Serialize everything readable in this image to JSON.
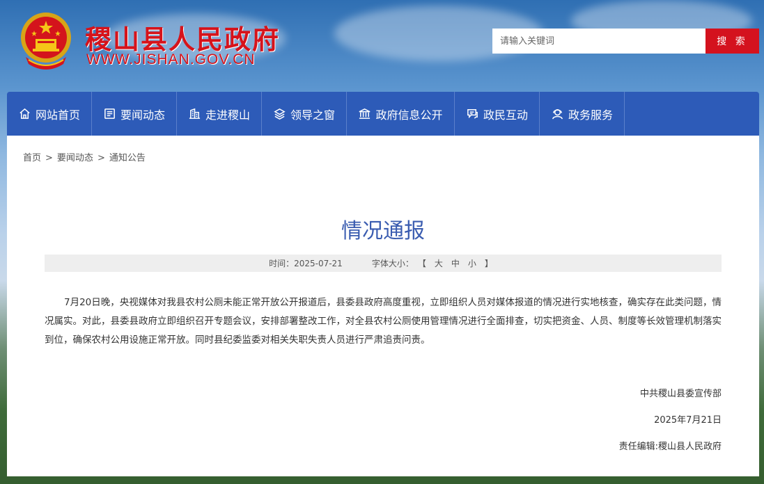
{
  "header": {
    "site_name": "稷山县人民政府",
    "site_url": "WWW.JISHAN.GOV.CN",
    "search": {
      "placeholder": "请输入关键词",
      "button_label": "搜 索"
    }
  },
  "nav": {
    "items": [
      {
        "label": "网站首页",
        "icon": "home-icon"
      },
      {
        "label": "要闻动态",
        "icon": "news-icon"
      },
      {
        "label": "走进稷山",
        "icon": "building-icon"
      },
      {
        "label": "领导之窗",
        "icon": "layers-icon"
      },
      {
        "label": "政府信息公开",
        "icon": "government-icon"
      },
      {
        "label": "政民互动",
        "icon": "chat-icon"
      },
      {
        "label": "政务服务",
        "icon": "service-icon"
      }
    ]
  },
  "breadcrumb": {
    "items": [
      "首页",
      "要闻动态",
      "通知公告"
    ],
    "separator": ">"
  },
  "article": {
    "title": "情况通报",
    "time_label": "时间：2025-07-21",
    "font_size_label": "字体大小：",
    "font_sizes": [
      "大",
      "中",
      "小"
    ],
    "bracket_open": "【",
    "bracket_close": "】",
    "body": "7月20日晚，央视媒体对我县农村公厕未能正常开放公开报道后，县委县政府高度重视，立即组织人员对媒体报道的情况进行实地核查，确实存在此类问题，情况属实。对此，县委县政府立即组织召开专题会议，安排部署整改工作，对全县农村公厕使用管理情况进行全面排查，切实把资金、人员、制度等长效管理机制落实到位，确保农村公用设施正常开放。同时县纪委监委对相关失职失责人员进行严肃追责问责。",
    "signature": "中共稷山县委宣传部",
    "date": "2025年7月21日",
    "editor": "责任编辑:稷山县人民政府"
  },
  "colors": {
    "brand_red": "#d6131b",
    "nav_blue": "#2d5bb8",
    "title_blue": "#3a5cb0"
  }
}
